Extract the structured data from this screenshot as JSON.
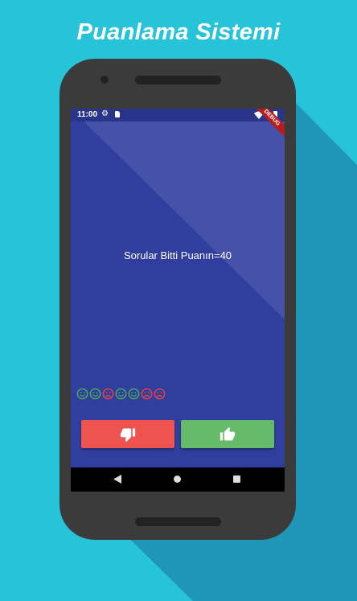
{
  "promo": {
    "title": "Puanlama Sistemi"
  },
  "status_bar": {
    "time": "11:00",
    "icons": [
      "gear-icon",
      "sd-card-icon",
      "wifi-icon",
      "battery-icon"
    ],
    "debug_label": "DEBUG"
  },
  "quiz": {
    "result_text": "Sorular Bitti Puanın=40"
  },
  "score_keeper": [
    "correct",
    "correct",
    "wrong",
    "correct",
    "correct",
    "wrong",
    "wrong"
  ],
  "buttons": {
    "wrong_icon": "thumbs-down-icon",
    "right_icon": "thumbs-up-icon"
  },
  "nav_bar": {
    "icons": [
      "back-icon",
      "home-icon",
      "recents-icon"
    ]
  },
  "colors": {
    "background": "#27c3d9",
    "app_background": "#303f9f",
    "correct": "#4caf50",
    "wrong": "#f44336",
    "wrong_button": "#ef5350",
    "right_button": "#66bb6a"
  }
}
